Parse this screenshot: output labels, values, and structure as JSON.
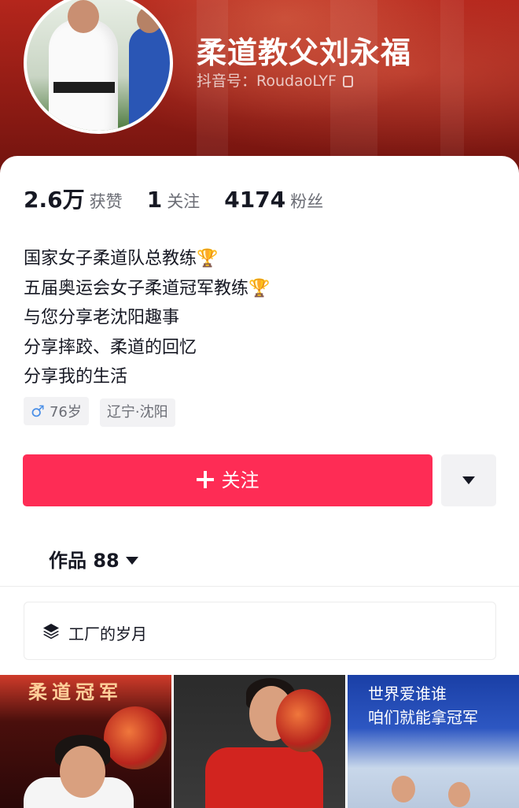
{
  "profile": {
    "nickname": "柔道教父刘永福",
    "douyin_id": "抖音号：RoudaoLYF"
  },
  "stats": [
    {
      "value": "2.6万",
      "label": "获赞"
    },
    {
      "value": "1",
      "label": "关注"
    },
    {
      "value": "4174",
      "label": "粉丝"
    }
  ],
  "bio": [
    "国家女子柔道队总教练🏆",
    "五届奥运会女子柔道冠军教练🏆",
    "与您分享老沈阳趣事",
    "分享摔跤、柔道的回忆",
    "分享我的生活"
  ],
  "tags": {
    "gender_symbol": "♂",
    "age": "76岁",
    "location": "辽宁·沈阳"
  },
  "actions": {
    "follow_label": "关注"
  },
  "tabs": {
    "works_label": "作品 88"
  },
  "collection": {
    "label": "工厂的岁月"
  },
  "thumbnails": {
    "thumb1_title": "柔道冠军",
    "thumb3_line1": "世界爱谁谁",
    "thumb3_line2": "咱们就能拿冠军"
  },
  "colors": {
    "accent": "#fe2c55",
    "banner": "#b4261c"
  }
}
